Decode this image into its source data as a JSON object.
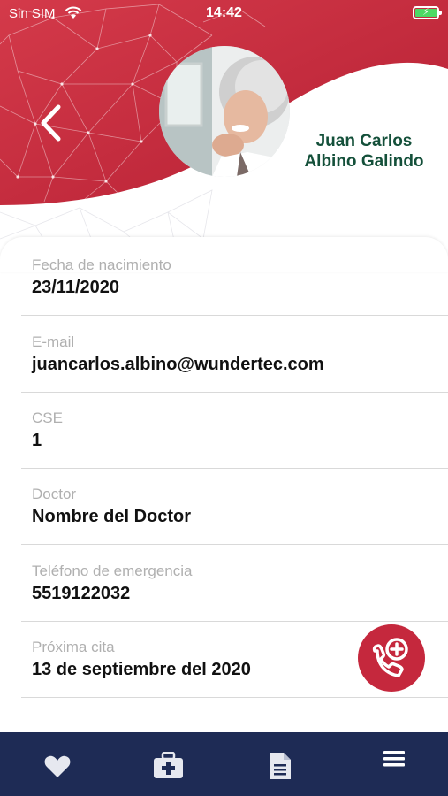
{
  "status_bar": {
    "carrier": "Sin SIM",
    "time": "14:42",
    "battery_state": "charging"
  },
  "header": {
    "back_icon": "chevron-left-icon",
    "name_line1": "Juan Carlos",
    "name_line2": "Albino Galindo"
  },
  "profile": {
    "fields": [
      {
        "label": "Fecha de nacimiento",
        "value": "23/11/2020"
      },
      {
        "label": "E-mail",
        "value": "juancarlos.albino@wundertec.com"
      },
      {
        "label": "CSE",
        "value": "1"
      },
      {
        "label": "Doctor",
        "value": "Nombre del Doctor"
      },
      {
        "label": "Teléfono de emergencia",
        "value": "5519122032"
      },
      {
        "label": "Próxima cita",
        "value": "13 de septiembre del 2020"
      }
    ],
    "call_button_icon": "phone-plus-icon"
  },
  "bottom_nav": {
    "items": [
      {
        "icon": "heart-icon"
      },
      {
        "icon": "medical-kit-icon"
      },
      {
        "icon": "document-icon"
      },
      {
        "icon": "menu-icon"
      }
    ]
  },
  "colors": {
    "brand_red": "#c5283d",
    "nav_navy": "#1e2b55",
    "name_green": "#14503a"
  }
}
